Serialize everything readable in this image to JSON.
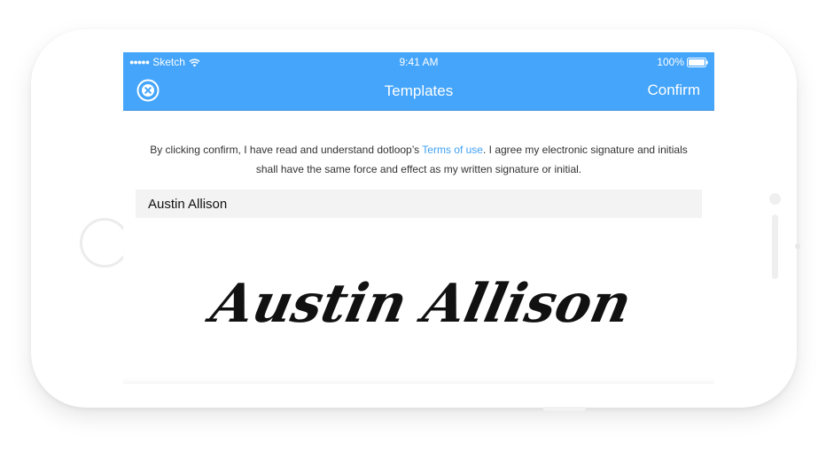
{
  "status_bar": {
    "signal": "●●●●●",
    "carrier": "Sketch",
    "time": "9:41 AM",
    "battery": "100%"
  },
  "nav": {
    "title": "Templates",
    "confirm_label": "Confirm"
  },
  "terms": {
    "before_link": "By clicking confirm, I have read and understand dotloop’s ",
    "link_text": "Terms of use",
    "after_link": ". I agree my electronic signature and initials shall have the same force and effect as my written signature or initial."
  },
  "signer": {
    "name": "Austin Allison",
    "signature": "Austin Allison"
  },
  "colors": {
    "accent": "#44a5fb",
    "link": "#3ea0f5",
    "name_bar_bg": "#f3f3f3"
  },
  "icons": {
    "close": "close-circle-icon",
    "wifi": "wifi-icon",
    "battery": "battery-icon"
  }
}
